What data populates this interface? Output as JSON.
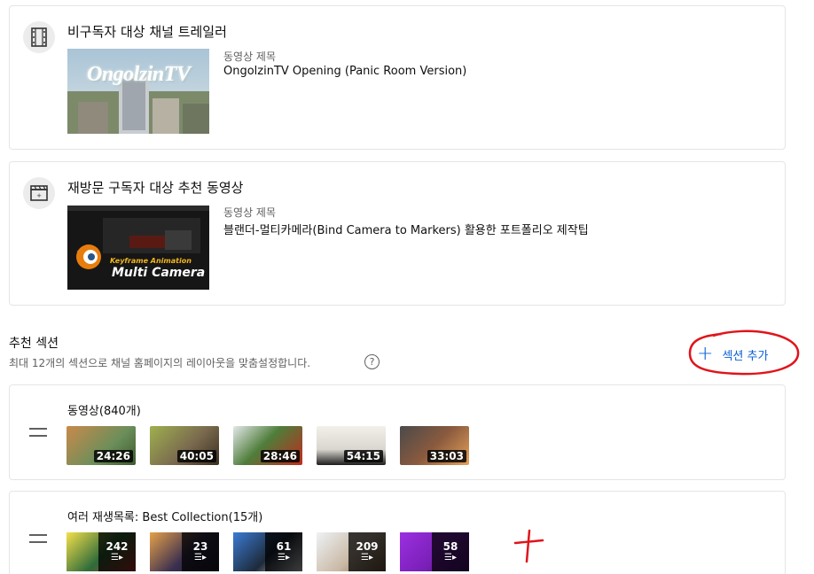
{
  "trailer": {
    "title": "비구독자 대상 채널 트레일러",
    "icon": "film-strip-icon",
    "video_label": "동영상 제목",
    "video_title": "OngolzinTV Opening (Panic Room Version)",
    "thumb_text": "OngolzinTV"
  },
  "returning": {
    "title": "재방문 구독자 대상 추천 동영상",
    "icon": "clapperboard-icon",
    "video_label": "동영상 제목",
    "video_title": "블랜더-멀티카메라(Bind Camera to Markers) 활용한 포트폴리오 제작팁",
    "thumb_line1": "Keyframe Animation",
    "thumb_line2": "Multi Camera"
  },
  "sections": {
    "heading": "추천 섹션",
    "description": "최대 12개의 섹션으로 채널 홈페이지의 레이아웃을 맞춤설정합니다.",
    "help": "?",
    "add_label": "섹션 추가",
    "add_icon": "+"
  },
  "videos_section": {
    "title": "동영상(840개)",
    "items": [
      {
        "duration": "24:26",
        "color": "#6b8e5a"
      },
      {
        "duration": "40:05",
        "color": "#7a6a4f"
      },
      {
        "duration": "28:46",
        "color": "#4f7d3a"
      },
      {
        "duration": "54:15",
        "color": "#d9d6cf"
      },
      {
        "duration": "33:03",
        "color": "#8a5a3e"
      }
    ]
  },
  "playlists_section": {
    "title": "여러 재생목록: Best Collection(15개)",
    "items": [
      {
        "count": "242",
        "color": "#2e6b3a"
      },
      {
        "count": "23",
        "color": "#3a2f4f"
      },
      {
        "count": "61",
        "color": "#1e2a3a"
      },
      {
        "count": "209",
        "color": "#c9b8a4"
      },
      {
        "count": "58",
        "color": "#7a1fb8"
      }
    ]
  },
  "colors": {
    "accent": "#065fd4",
    "annotation": "#e0141b"
  }
}
